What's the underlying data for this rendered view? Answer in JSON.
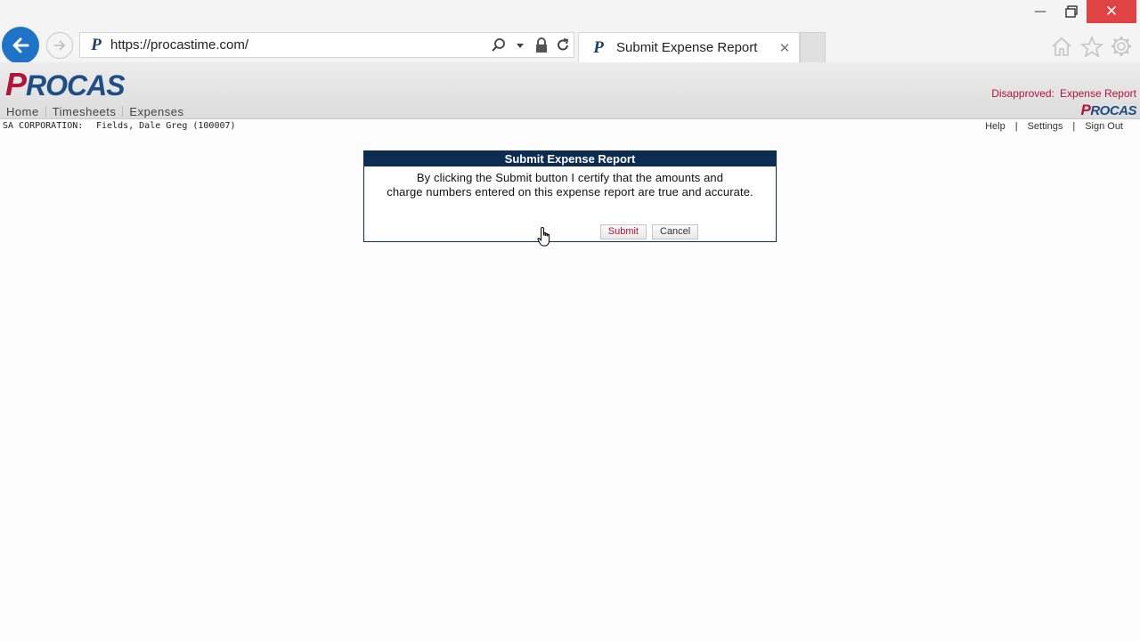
{
  "browser": {
    "url": "https://procastime.com/",
    "tab_title": "Submit Expense Report",
    "tab_close": "✕"
  },
  "app": {
    "logo_text": "ROCAS",
    "logo_p": "P",
    "small_logo_p": "P",
    "small_logo_text": "ROCAS",
    "status_label": "Disapproved:",
    "status_value": "Expense Report",
    "menu": [
      "Home",
      "Timesheets",
      "Expenses"
    ],
    "company": "SA CORPORATION:",
    "user": "Fields, Dale Greg (100007)",
    "links": [
      "Help",
      "Settings",
      "Sign Out"
    ],
    "link_separator": "|"
  },
  "dialog": {
    "title": "Submit Expense Report",
    "line1": "By clicking the Submit button I certify that the amounts and",
    "line2": "charge numbers entered on this expense report are true and accurate.",
    "submit_label": "Submit",
    "cancel_label": "Cancel"
  },
  "colors": {
    "brand_red": "#b3143a",
    "brand_blue": "#1d4f86",
    "dialog_title_bg": "#0c2c52",
    "browser_back": "#1e73c8",
    "window_close": "#e04343"
  },
  "icons": [
    "minimize-icon",
    "restore-icon",
    "close-icon",
    "back-arrow-icon",
    "forward-arrow-icon",
    "search-icon",
    "dropdown-icon",
    "lock-icon",
    "refresh-icon",
    "home-icon",
    "star-icon",
    "gear-icon",
    "hand-cursor-icon"
  ]
}
